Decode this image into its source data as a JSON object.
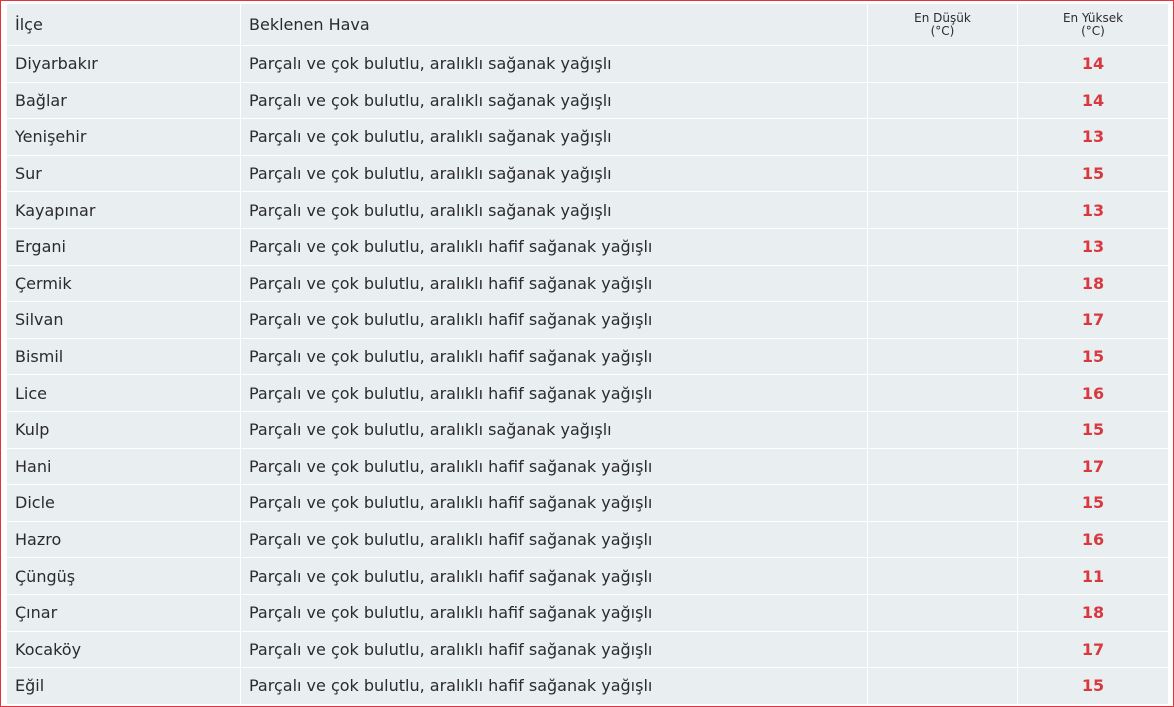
{
  "table": {
    "headers": {
      "district": "İlçe",
      "expected": "Beklenen Hava",
      "min_line1": "En Düşük",
      "min_line2": "(°C)",
      "max_line1": "En Yüksek",
      "max_line2": "(°C)"
    },
    "rows": [
      {
        "district": "Diyarbakır",
        "weather": "Parçalı ve çok bulutlu, aralıklı sağanak yağışlı",
        "min": "",
        "max": "14"
      },
      {
        "district": "Bağlar",
        "weather": "Parçalı ve çok bulutlu, aralıklı sağanak yağışlı",
        "min": "",
        "max": "14"
      },
      {
        "district": "Yenişehir",
        "weather": "Parçalı ve çok bulutlu, aralıklı sağanak yağışlı",
        "min": "",
        "max": "13"
      },
      {
        "district": "Sur",
        "weather": "Parçalı ve çok bulutlu, aralıklı sağanak yağışlı",
        "min": "",
        "max": "15"
      },
      {
        "district": "Kayapınar",
        "weather": "Parçalı ve çok bulutlu, aralıklı sağanak yağışlı",
        "min": "",
        "max": "13"
      },
      {
        "district": "Ergani",
        "weather": "Parçalı ve çok bulutlu, aralıklı hafif sağanak yağışlı",
        "min": "",
        "max": "13"
      },
      {
        "district": "Çermik",
        "weather": "Parçalı ve çok bulutlu, aralıklı hafif sağanak yağışlı",
        "min": "",
        "max": "18"
      },
      {
        "district": "Silvan",
        "weather": "Parçalı ve çok bulutlu, aralıklı hafif sağanak yağışlı",
        "min": "",
        "max": "17"
      },
      {
        "district": "Bismil",
        "weather": "Parçalı ve çok bulutlu, aralıklı hafif sağanak yağışlı",
        "min": "",
        "max": "15"
      },
      {
        "district": "Lice",
        "weather": "Parçalı ve çok bulutlu, aralıklı hafif sağanak yağışlı",
        "min": "",
        "max": "16"
      },
      {
        "district": "Kulp",
        "weather": "Parçalı ve çok bulutlu, aralıklı sağanak yağışlı",
        "min": "",
        "max": "15"
      },
      {
        "district": "Hani",
        "weather": "Parçalı ve çok bulutlu, aralıklı hafif sağanak yağışlı",
        "min": "",
        "max": "17"
      },
      {
        "district": "Dicle",
        "weather": "Parçalı ve çok bulutlu, aralıklı hafif sağanak yağışlı",
        "min": "",
        "max": "15"
      },
      {
        "district": "Hazro",
        "weather": "Parçalı ve çok bulutlu, aralıklı hafif sağanak yağışlı",
        "min": "",
        "max": "16"
      },
      {
        "district": "Çüngüş",
        "weather": "Parçalı ve çok bulutlu, aralıklı hafif sağanak yağışlı",
        "min": "",
        "max": "11"
      },
      {
        "district": "Çınar",
        "weather": "Parçalı ve çok bulutlu, aralıklı hafif sağanak yağışlı",
        "min": "",
        "max": "18"
      },
      {
        "district": "Kocaköy",
        "weather": "Parçalı ve çok bulutlu, aralıklı hafif sağanak yağışlı",
        "min": "",
        "max": "17"
      },
      {
        "district": "Eğil",
        "weather": "Parçalı ve çok bulutlu, aralıklı hafif sağanak yağışlı",
        "min": "",
        "max": "15"
      }
    ]
  },
  "colors": {
    "frame_border": "#e0353b",
    "cell_background": "#e9eef1",
    "max_temperature": "#d9393e",
    "text": "#2b2b2b"
  }
}
